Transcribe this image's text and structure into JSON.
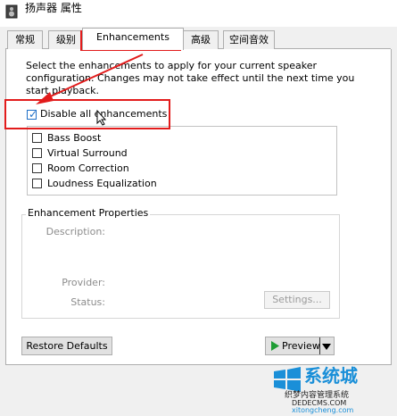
{
  "window": {
    "title": "扬声器 属性"
  },
  "tabs": [
    {
      "label": "常规"
    },
    {
      "label": "级别"
    },
    {
      "label": "Enhancements"
    },
    {
      "label": "高级"
    },
    {
      "label": "空间音效"
    }
  ],
  "enhancements": {
    "description": "Select the enhancements to apply for your current speaker configuration. Changes may not take effect until the next time you start playback.",
    "disable_all_label": "Disable all enhancements",
    "disable_all_checked": true,
    "items": [
      {
        "label": "Bass Boost",
        "checked": false
      },
      {
        "label": "Virtual Surround",
        "checked": false
      },
      {
        "label": "Room Correction",
        "checked": false
      },
      {
        "label": "Loudness Equalization",
        "checked": false
      }
    ]
  },
  "properties": {
    "group_title": "Enhancement Properties",
    "description_label": "Description:",
    "provider_label": "Provider:",
    "status_label": "Status:",
    "settings_button": "Settings..."
  },
  "footer": {
    "restore_button": "Restore Defaults",
    "preview_button": "Preview"
  },
  "watermark": {
    "brand": "系统城",
    "line1": "织梦内容管理系统",
    "line2": "DEDECMS.COM",
    "line3": "xitongcheng.com"
  },
  "colors": {
    "annotation_red": "#e21b1b",
    "check_blue": "#1e6fc7",
    "preview_green": "#1f9d35"
  }
}
